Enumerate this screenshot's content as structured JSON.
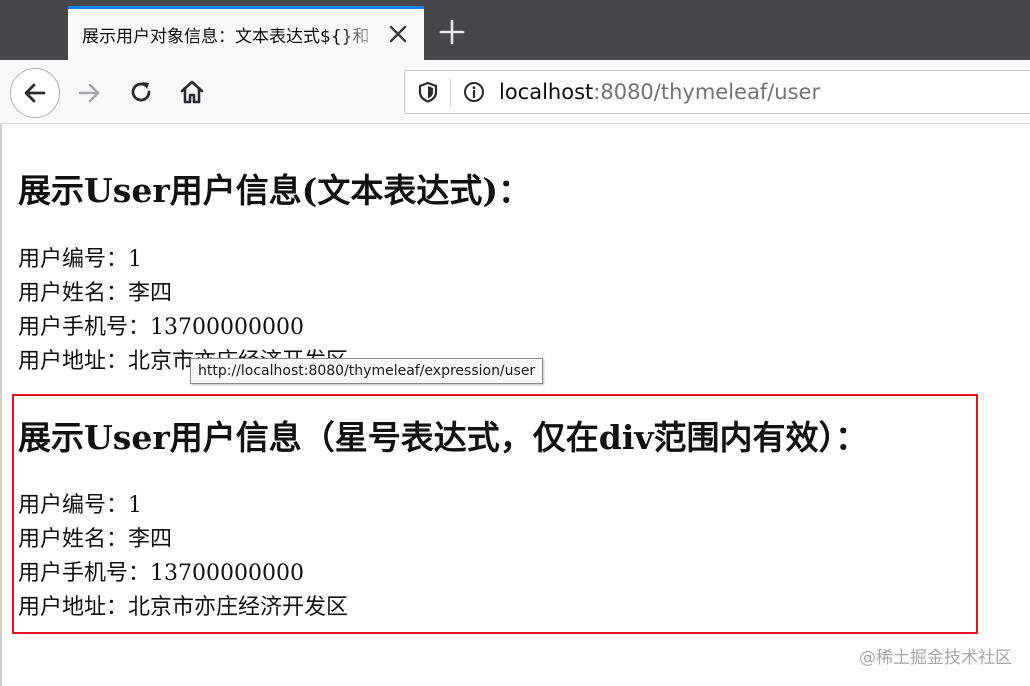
{
  "browser": {
    "tab": {
      "title": "展示用户对象信息：文本表达式${}和"
    },
    "url": {
      "host": "localhost",
      "rest": ":8080/thymeleaf/user"
    }
  },
  "page": {
    "section1": {
      "title": "展示User用户信息(文本表达式)：",
      "fields": [
        "用户编号：1",
        "用户姓名：李四",
        "用户手机号：13700000000",
        "用户地址：北京市亦庄经济开发区"
      ]
    },
    "section2": {
      "title": "展示User用户信息（星号表达式，仅在div范围内有效）：",
      "fields": [
        "用户编号：1",
        "用户姓名：李四",
        "用户手机号：13700000000",
        "用户地址：北京市亦庄经济开发区"
      ]
    },
    "tooltip": "http://localhost:8080/thymeleaf/expression/user",
    "highlight_color": "#e0161c"
  },
  "watermark": "@稀土掘金技术社区",
  "icons": {
    "back": "back-arrow-icon",
    "forward": "forward-arrow-icon",
    "reload": "reload-icon",
    "home": "home-icon",
    "tracking": "shield-icon",
    "site_info": "info-icon",
    "close_tab": "close-icon",
    "new_tab": "plus-icon"
  }
}
